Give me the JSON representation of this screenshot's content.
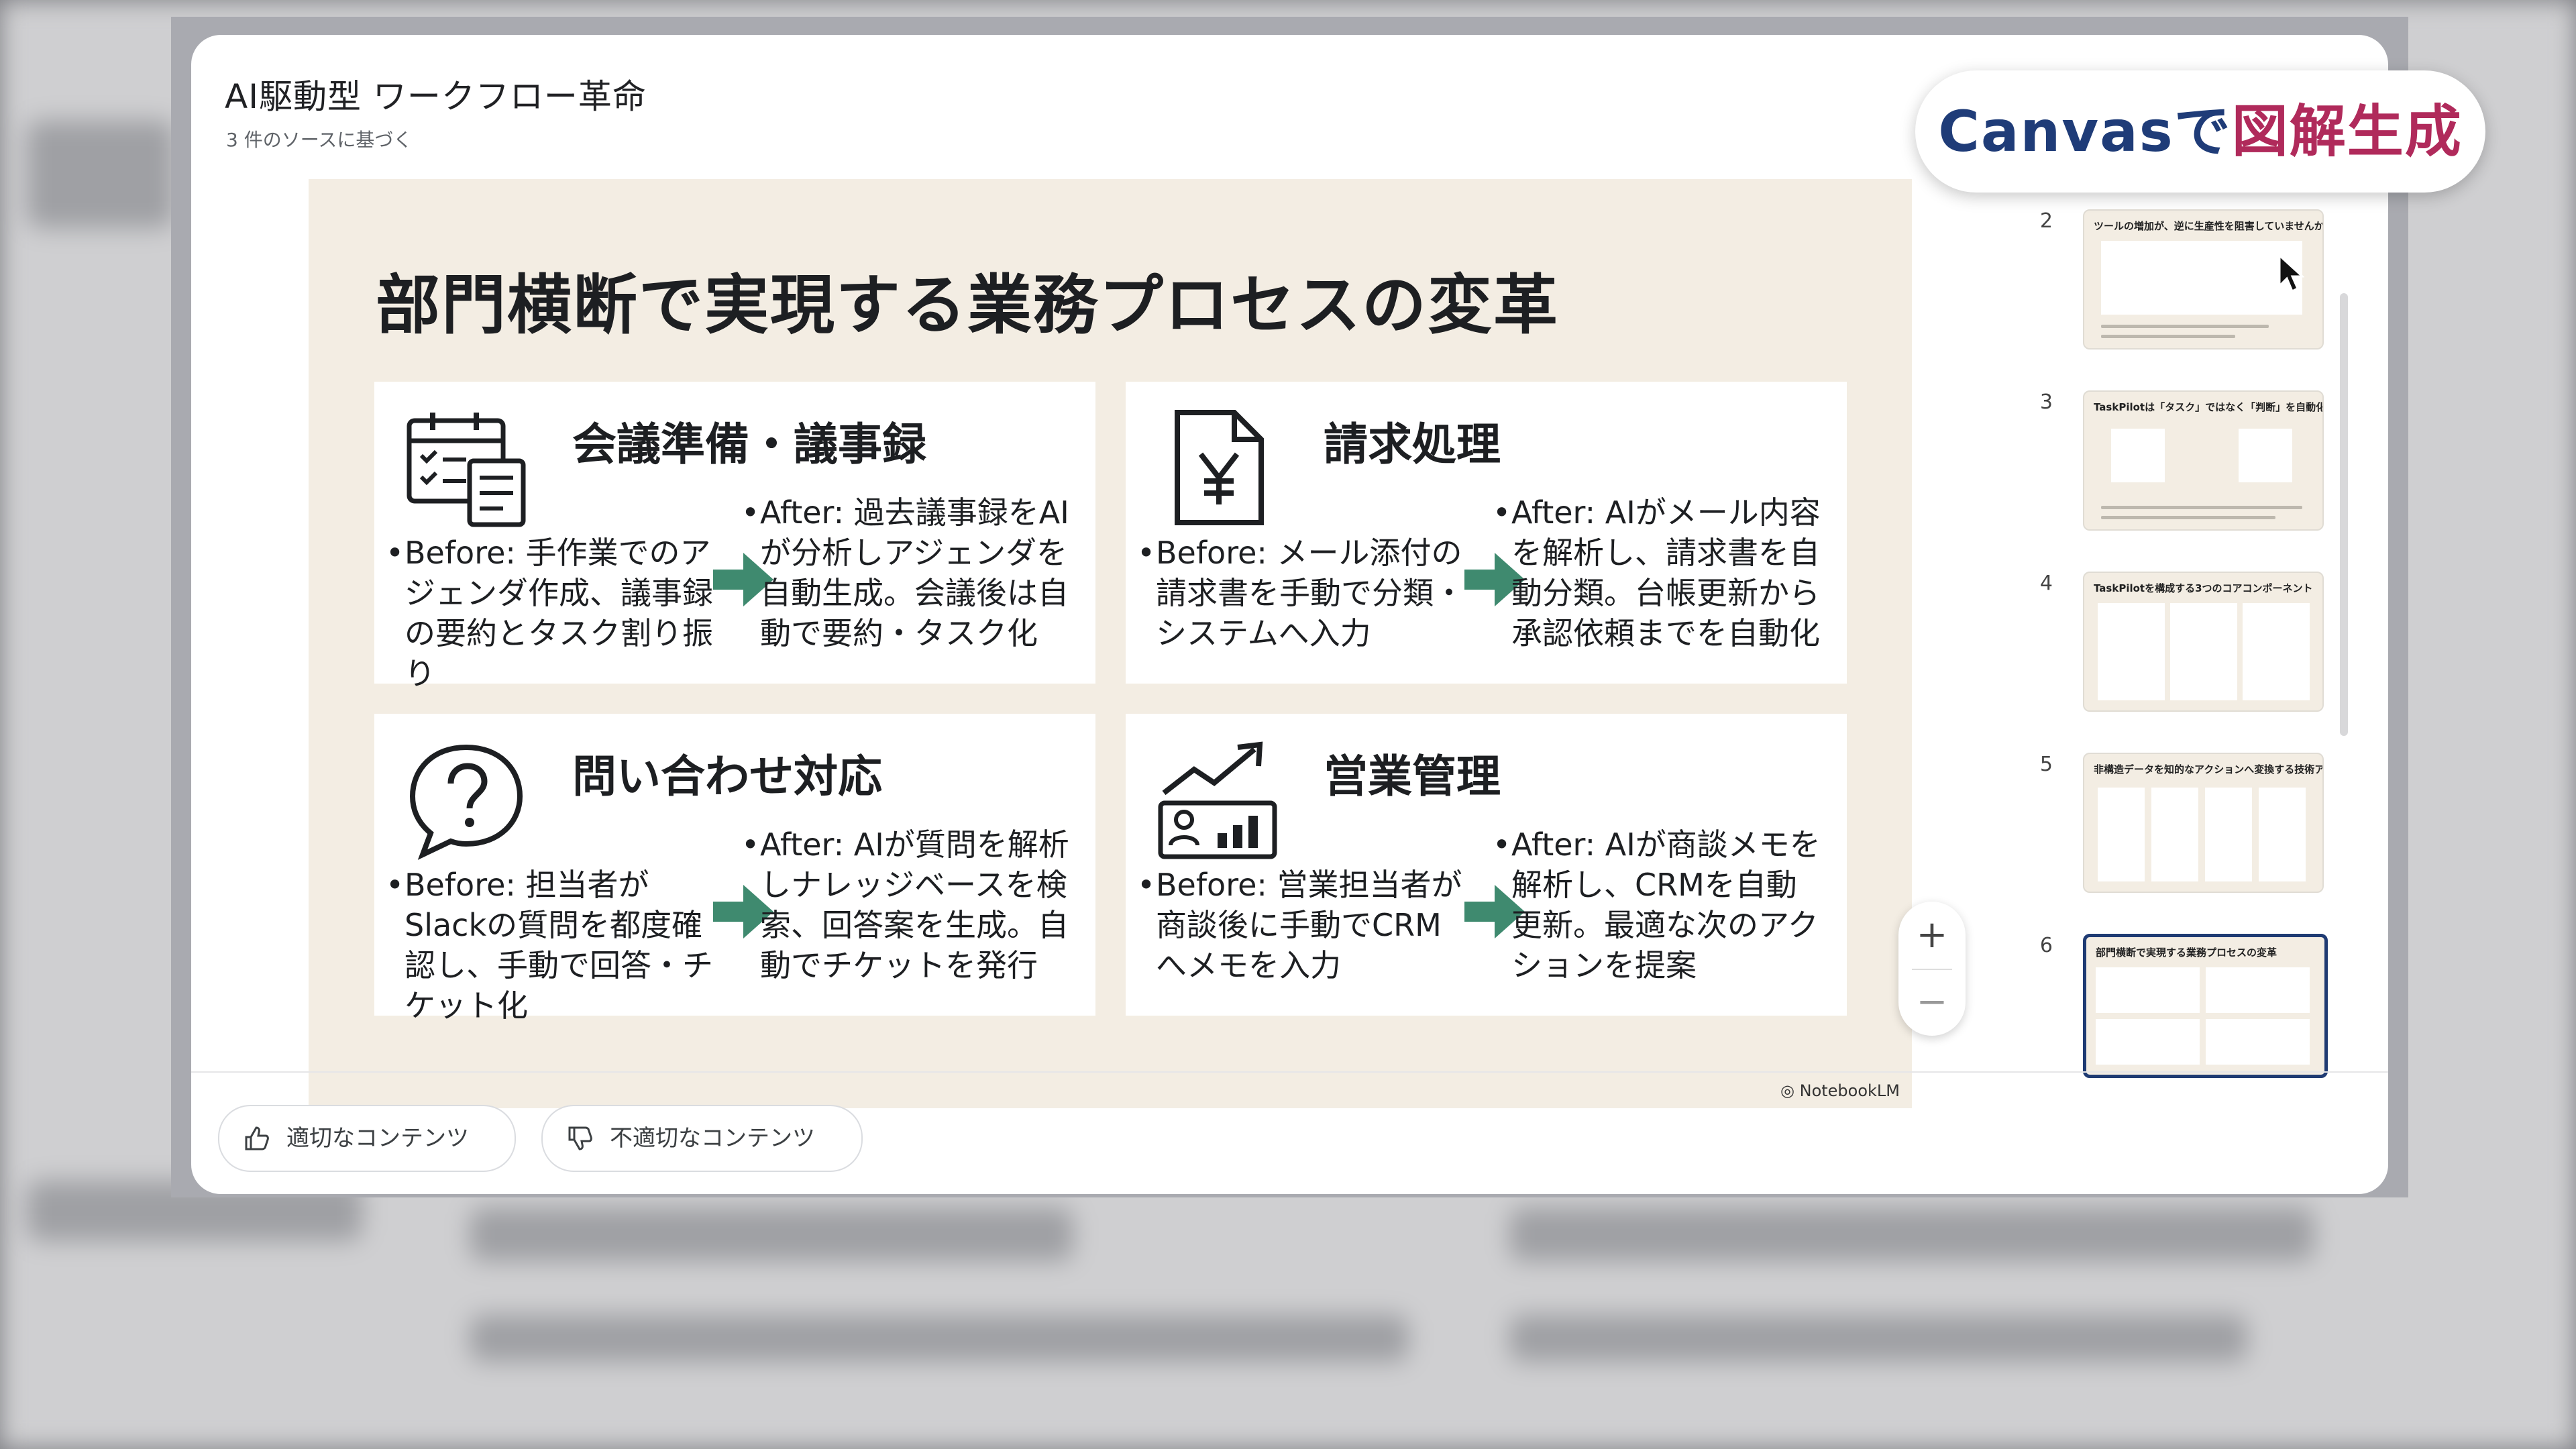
{
  "modal": {
    "title": "AI駆動型 ワークフロー革命",
    "subtitle": "3 件のソースに基づく"
  },
  "slide": {
    "title": "部門横断で実現する業務プロセスの変革",
    "brand": "NotebookLM",
    "cards": [
      {
        "title": "会議準備・議事録",
        "icon": "calendar-checklist-icon",
        "before": "Before: 手作業でのアジェンダ作成、議事録の要約とタスク割り振り",
        "after": "After: 過去議事録をAIが分析しアジェンダを自動生成。会議後は自動で要約・タスク化"
      },
      {
        "title": "請求処理",
        "icon": "yen-document-icon",
        "before": "Before: メール添付の請求書を手動で分類・システムへ入力",
        "after": "After: AIがメール内容を解析し、請求書を自動分類。台帳更新から承認依頼までを自動化"
      },
      {
        "title": "問い合わせ対応",
        "icon": "question-bubble-icon",
        "before": "Before: 担当者がSlackの質問を都度確認し、手動で回答・チケット化",
        "after": "After: AIが質問を解析しナレッジベースを検索、回答案を生成。自動でチケットを発行"
      },
      {
        "title": "営業管理",
        "icon": "sales-growth-icon",
        "before": "Before: 営業担当者が商談後に手動でCRMへメモを入力",
        "after": "After: AIが商談メモを解析し、CRMを自動更新。最適な次のアクションを提案"
      }
    ]
  },
  "zoom": {
    "plus": "+",
    "minus": "−"
  },
  "thumbnails": [
    {
      "num": "2",
      "title": "ツールの増加が、逆に生産性を阻害していませんか？"
    },
    {
      "num": "3",
      "title": "TaskPilotは「タスク」ではなく「判断」を自動化します"
    },
    {
      "num": "4",
      "title": "TaskPilotを構成する3つのコアコンポーネント"
    },
    {
      "num": "5",
      "title": "非構造データを知的なアクションへ変換する技術アーキテクチャ"
    },
    {
      "num": "6",
      "title": "部門横断で実現する業務プロセスの変革"
    }
  ],
  "feedback": {
    "good": "適切なコンテンツ",
    "bad": "不適切なコンテンツ"
  },
  "badge": {
    "part1": "Canvasで",
    "part2": "図解生成"
  },
  "colors": {
    "slide_bg": "#f3ede3",
    "arrow": "#3f8a6f",
    "badge_blue": "#1f3c78",
    "badge_red": "#b02a5b",
    "active_thumb": "#1f3b73"
  }
}
